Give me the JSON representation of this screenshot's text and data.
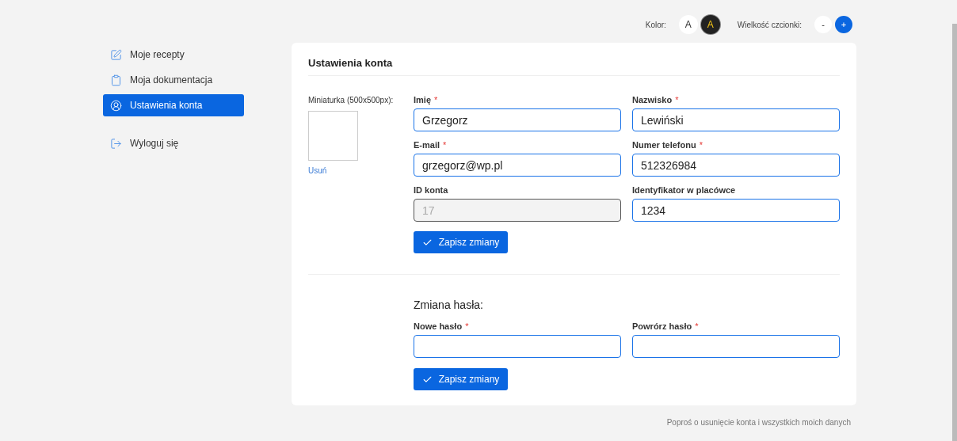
{
  "toolbar": {
    "color_label": "Kolor:",
    "color_options": [
      {
        "label": "A",
        "kind": "light",
        "selected": false
      },
      {
        "label": "A",
        "kind": "dark",
        "selected": true
      }
    ],
    "font_size_label": "Wielkość czcionki:",
    "font_buttons": [
      {
        "label": "-",
        "kind": "plain"
      },
      {
        "label": "+",
        "kind": "primary"
      }
    ]
  },
  "sidebar": {
    "items": [
      {
        "label": "Moje recepty",
        "selected": false
      },
      {
        "label": "Moja dokumentacja",
        "selected": false
      },
      {
        "label": "Ustawienia konta",
        "selected": true
      },
      {
        "label": "Wyloguj się",
        "selected": false
      }
    ]
  },
  "card": {
    "title": "Ustawienia konta",
    "thumbnail": {
      "label": "Miniaturka (500x500px):",
      "remove_link": "Usuń"
    },
    "fields": [
      {
        "label": "Imię",
        "required_mark": "*",
        "value": "Grzegorz",
        "disabled": false
      },
      {
        "label": "Nazwisko",
        "required_mark": "*",
        "value": "Lewiński",
        "disabled": false
      },
      {
        "label": "E-mail",
        "required_mark": "*",
        "value": "grzegorz@wp.pl",
        "disabled": false
      },
      {
        "label": "Numer telefonu",
        "required_mark": "*",
        "value": "512326984",
        "disabled": false
      },
      {
        "label": "ID konta",
        "value": "17",
        "disabled": true
      },
      {
        "label": "Identyfikator w placówce",
        "value": "1234",
        "disabled": false
      }
    ],
    "save_button": "Zapisz zmiany",
    "password": {
      "title": "Zmiana hasła:",
      "fields": [
        {
          "label": "Nowe hasło",
          "required_mark": "*",
          "disabled": false
        },
        {
          "label": "Powrórz hasło",
          "required_mark": "*",
          "disabled": false
        }
      ],
      "save_button": "Zapisz zmiany"
    }
  },
  "footer_link": "Poproś o usunięcie konta i wszystkich moich danych"
}
